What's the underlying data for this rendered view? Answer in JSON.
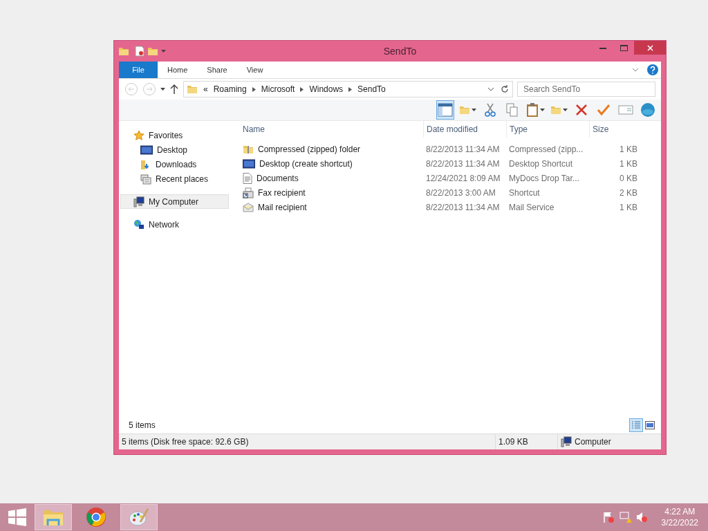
{
  "window": {
    "title": "SendTo"
  },
  "ribbon_tabs": [
    {
      "label": "File",
      "kind": "file"
    },
    {
      "label": "Home",
      "kind": "tab"
    },
    {
      "label": "Share",
      "kind": "tab"
    },
    {
      "label": "View",
      "kind": "tab"
    }
  ],
  "address": {
    "overflow": "«",
    "breadcrumbs": [
      "Roaming",
      "Microsoft",
      "Windows",
      "SendTo"
    ]
  },
  "search": {
    "placeholder": "Search SendTo"
  },
  "nav": [
    {
      "label": "Favorites",
      "kind": "star",
      "selected": false,
      "children": [
        {
          "label": "Desktop",
          "kind": "desktop",
          "selected": false
        },
        {
          "label": "Downloads",
          "kind": "downloads",
          "selected": false
        },
        {
          "label": "Recent places",
          "kind": "recent",
          "selected": false
        }
      ]
    },
    {
      "label": "My Computer",
      "kind": "computer",
      "selected": true
    },
    {
      "label": "Network",
      "kind": "network",
      "selected": false
    }
  ],
  "columns": [
    "Name",
    "Date modified",
    "Type",
    "Size"
  ],
  "rows": [
    {
      "kind": "zip",
      "name": "Compressed (zipped) folder",
      "date": "8/22/2013 11:34 AM",
      "type": "Compressed (zipp...",
      "size": "1 KB"
    },
    {
      "kind": "desktop",
      "name": "Desktop (create shortcut)",
      "date": "8/22/2013 11:34 AM",
      "type": "Desktop Shortcut",
      "size": "1 KB"
    },
    {
      "kind": "document",
      "name": "Documents",
      "date": "12/24/2021 8:09 AM",
      "type": "MyDocs Drop Tar...",
      "size": "0 KB"
    },
    {
      "kind": "fax",
      "name": "Fax recipient",
      "date": "8/22/2013 3:00 AM",
      "type": "Shortcut",
      "size": "2 KB"
    },
    {
      "kind": "mail",
      "name": "Mail recipient",
      "date": "8/22/2013 11:34 AM",
      "type": "Mail Service",
      "size": "1 KB"
    }
  ],
  "item_count": "5 items",
  "view_buttons": [
    {
      "kind": "details",
      "selected": true
    },
    {
      "kind": "tiles",
      "selected": false
    }
  ],
  "status_bar": {
    "summary": "5 items (Disk free space: 92.6 GB)",
    "size": "1.09 KB",
    "location": "Computer"
  },
  "taskbar": {
    "apps": [
      {
        "kind": "explorer",
        "selected": true
      },
      {
        "kind": "chrome",
        "selected": false
      },
      {
        "kind": "paint",
        "selected": true
      }
    ],
    "time": "4:22 AM",
    "date": "3/22/2022"
  }
}
